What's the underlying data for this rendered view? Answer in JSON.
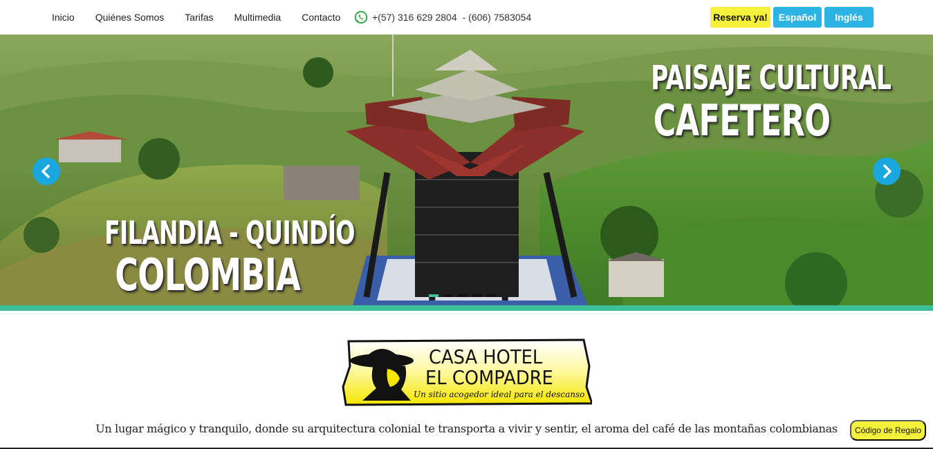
{
  "nav": {
    "links": [
      "Inicio",
      "Quiénes Somos",
      "Tarifas",
      "Multimedia",
      "Contacto"
    ],
    "phone_icon": "whatsapp-icon",
    "phone_primary": "+(57) 316 629 2804",
    "phone_secondary": "- (606) 7583054"
  },
  "buttons": {
    "reserva": "Reserva ya!",
    "espanol": "Español",
    "ingles": "Inglés"
  },
  "hero": {
    "headline_right_1": "PAISAJE CULTURAL",
    "headline_right_2": "CAFETERO",
    "headline_left_1": "FILANDIA - QUINDÍO",
    "headline_left_2": "COLOMBIA",
    "prev_icon": "chevron-left-icon",
    "next_icon": "chevron-right-icon",
    "slide_count": 5,
    "active_slide": 1
  },
  "logo": {
    "title_line1": "CASA HOTEL",
    "title_line2": "EL COMPADRE",
    "tagline": "Un sitio acogedor ideal para el descanso"
  },
  "slogan": "Un lugar mágico y tranquilo, donde su arquitectura colonial te transporta a vivir y sentir, el aroma del café de las montañas colombianas",
  "gift_button": "Código de Regalo",
  "colors": {
    "accent_blue": "#2cb4e4",
    "accent_yellow": "#f6f13a",
    "teal": "#3dbf99"
  }
}
